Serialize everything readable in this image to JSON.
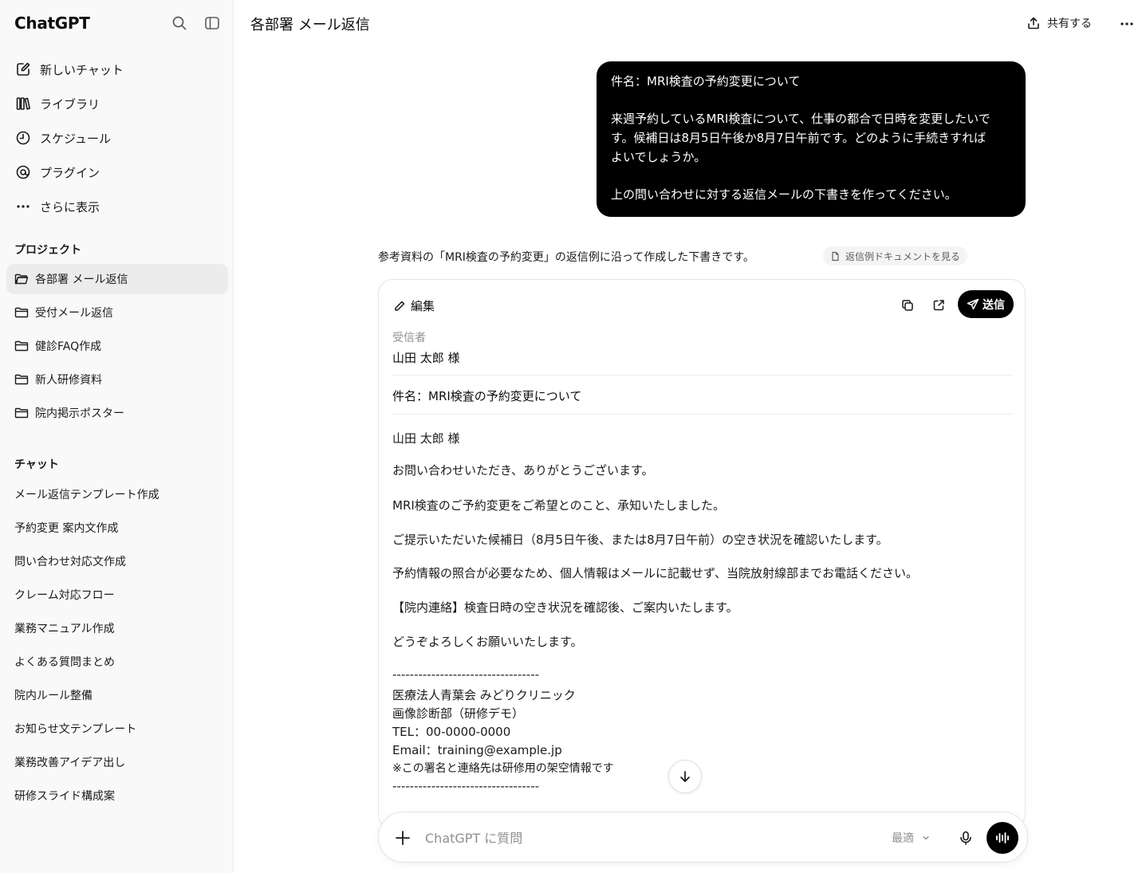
{
  "app": {
    "brand": "ChatGPT"
  },
  "sidebar": {
    "nav": [
      {
        "label": "新しいチャット",
        "icon": "new-chat-icon"
      },
      {
        "label": "ライブラリ",
        "icon": "library-icon"
      },
      {
        "label": "スケジュール",
        "icon": "clock-icon"
      },
      {
        "label": "プラグイン",
        "icon": "plugin-icon"
      },
      {
        "label": "さらに表示",
        "icon": "more-dots-icon"
      }
    ],
    "projects_label": "プロジェクト",
    "projects": [
      {
        "label": "各部署 メール返信",
        "active": true
      },
      {
        "label": "受付メール返信"
      },
      {
        "label": "健診FAQ作成"
      },
      {
        "label": "新人研修資料"
      },
      {
        "label": "院内掲示ポスター"
      }
    ],
    "chats_label": "チャット",
    "chats": [
      "メール返信テンプレート作成",
      "予約変更 案内文作成",
      "問い合わせ対応文作成",
      "クレーム対応フロー",
      "業務マニュアル作成",
      "よくある質問まとめ",
      "院内ルール整備",
      "お知らせ文テンプレート",
      "業務改善アイデア出し",
      "研修スライド構成案"
    ]
  },
  "header": {
    "title": "各部署 メール返信",
    "share_label": "共有する"
  },
  "user_message": {
    "subject_line": "件名：MRI検査の予約変更について",
    "body_lines": [
      "来週予約しているMRI検査について、仕事の都合で日時を変更したいで",
      "す。候補日は8月5日午後か8月7日午前です。どのように手続きすれば",
      "よいでしょうか。"
    ],
    "request": "上の問い合わせに対する返信メールの下書きを作ってください。"
  },
  "assistant": {
    "intro": "参考資料の「MRI検査の予約変更」の返信例に沿って作成した下書きです。",
    "doc_chip": "返信例ドキュメントを見る"
  },
  "email_card": {
    "edit_label": "編集",
    "send_label": "送信",
    "recipient_label": "受信者",
    "recipient": "山田 太郎 様",
    "subject": "件名：MRI検査の予約変更について",
    "body": [
      "山田 太郎 様",
      "お問い合わせいただき、ありがとうございます。",
      "MRI検査のご予約変更をご希望とのこと、承知いたしました。",
      "ご提示いただいた候補日（8月5日午後、または8月7日午前）の空き状況を確認いたします。",
      "予約情報の照合が必要なため、個人情報はメールに記載せず、当院放射線部までお電話ください。",
      "【院内連絡】検査日時の空き状況を確認後、ご案内いたします。",
      "どうぞよろしくお願いいたします。",
      "----------------------------------",
      "医療法人青葉会 みどりクリニック",
      "画像診断部（研修デモ）",
      "TEL：00-0000-0000",
      "Email：training@example.jp",
      "※この署名と連絡先は研修用の架空情報です",
      "----------------------------------"
    ]
  },
  "composer": {
    "placeholder": "ChatGPT に質問",
    "model": "最適"
  }
}
